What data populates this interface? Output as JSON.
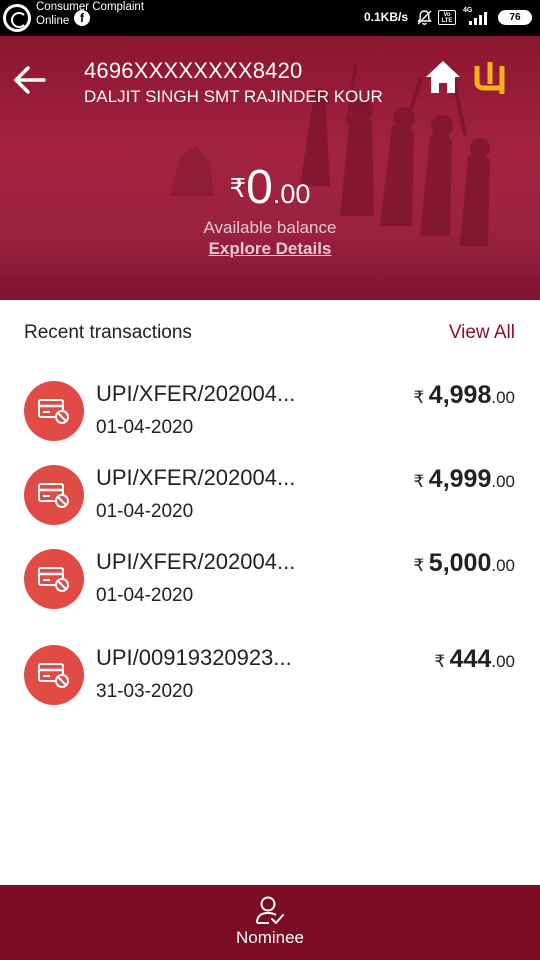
{
  "status_bar": {
    "notification_title": "Consumer Complaint",
    "notification_sub": "Online",
    "net_speed": "0.1KB/s",
    "volte": "Vo LTE",
    "network": "4G",
    "battery": "76"
  },
  "header": {
    "account_number": "4696XXXXXXXX8420",
    "account_holder": "DALJIT SINGH SMT RAJINDER KOUR",
    "balance_currency": "₹",
    "balance_whole": "0",
    "balance_decimal": ".00",
    "balance_label": "Available balance",
    "explore_label": "Explore Details",
    "brand_logo_text": "ψ",
    "brand_color": "#f3b21a",
    "header_color": "#9a1f3b"
  },
  "recent": {
    "title": "Recent transactions",
    "view_all": "View All",
    "accent_color": "#8a0f2a",
    "icon_color": "#e04b46",
    "transactions": [
      {
        "description": "UPI/XFER/202004...",
        "date": "01-04-2020",
        "currency": "₹",
        "amount_whole": "4,998",
        "amount_decimal": ".00"
      },
      {
        "description": "UPI/XFER/202004...",
        "date": "01-04-2020",
        "currency": "₹",
        "amount_whole": "4,999",
        "amount_decimal": ".00"
      },
      {
        "description": "UPI/XFER/202004...",
        "date": "01-04-2020",
        "currency": "₹",
        "amount_whole": "5,000",
        "amount_decimal": ".00"
      },
      {
        "description": "UPI/00919320923...",
        "date": "31-03-2020",
        "currency": "₹",
        "amount_whole": "444",
        "amount_decimal": ".00"
      }
    ]
  },
  "bottom_nav": {
    "nominee_label": "Nominee",
    "bar_color": "#7a0b22"
  }
}
